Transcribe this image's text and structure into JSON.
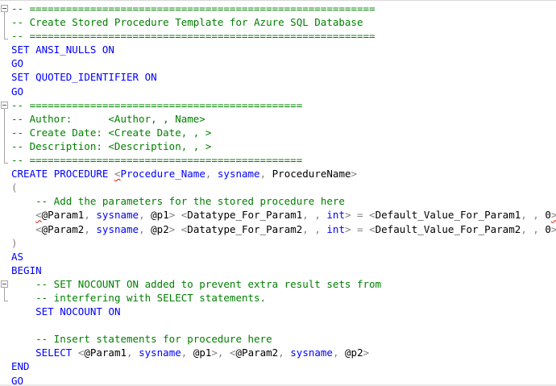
{
  "editor": {
    "lines": [
      [
        {
          "cls": "c",
          "text": "-- ========================================================="
        }
      ],
      [
        {
          "cls": "c",
          "text": "-- Create Stored Procedure Template for Azure SQL Database"
        }
      ],
      [
        {
          "cls": "c",
          "text": "-- ========================================================="
        }
      ],
      [
        {
          "cls": "k",
          "text": "SET"
        },
        {
          "cls": "p",
          "text": " "
        },
        {
          "cls": "k",
          "text": "ANSI_NULLS"
        },
        {
          "cls": "p",
          "text": " "
        },
        {
          "cls": "k",
          "text": "ON"
        }
      ],
      [
        {
          "cls": "k",
          "text": "GO"
        }
      ],
      [
        {
          "cls": "k",
          "text": "SET"
        },
        {
          "cls": "p",
          "text": " "
        },
        {
          "cls": "k",
          "text": "QUOTED_IDENTIFIER"
        },
        {
          "cls": "p",
          "text": " "
        },
        {
          "cls": "k",
          "text": "ON"
        }
      ],
      [
        {
          "cls": "k",
          "text": "GO"
        }
      ],
      [
        {
          "cls": "c",
          "text": "-- ============================================="
        }
      ],
      [
        {
          "cls": "c",
          "text": "-- Author:      <Author, , Name>"
        }
      ],
      [
        {
          "cls": "c",
          "text": "-- Create Date: <Create Date, , >"
        }
      ],
      [
        {
          "cls": "c",
          "text": "-- Description: <Description, , >"
        }
      ],
      [
        {
          "cls": "c",
          "text": "-- ============================================="
        }
      ],
      [
        {
          "cls": "k",
          "text": "CREATE"
        },
        {
          "cls": "p",
          "text": " "
        },
        {
          "cls": "k",
          "text": "PROCEDURE"
        },
        {
          "cls": "p",
          "text": " "
        },
        {
          "cls": "g squiggle",
          "text": "<"
        },
        {
          "cls": "t",
          "text": "Procedure_Name"
        },
        {
          "cls": "g",
          "text": ", "
        },
        {
          "cls": "t",
          "text": "sysname"
        },
        {
          "cls": "g",
          "text": ", "
        },
        {
          "cls": "p",
          "text": "ProcedureName"
        },
        {
          "cls": "g",
          "text": ">"
        }
      ],
      [
        {
          "cls": "g",
          "text": "("
        }
      ],
      [
        {
          "cls": "p",
          "text": "    "
        },
        {
          "cls": "c",
          "text": "-- Add the parameters for the stored procedure here"
        }
      ],
      [
        {
          "cls": "p",
          "text": "    "
        },
        {
          "cls": "g squiggle",
          "text": "<"
        },
        {
          "cls": "p",
          "text": "@Param1"
        },
        {
          "cls": "g",
          "text": ", "
        },
        {
          "cls": "t",
          "text": "sysname"
        },
        {
          "cls": "g",
          "text": ", "
        },
        {
          "cls": "p",
          "text": "@p1"
        },
        {
          "cls": "g",
          "text": "> <"
        },
        {
          "cls": "p",
          "text": "Datatype_For_Param1"
        },
        {
          "cls": "g",
          "text": ", , "
        },
        {
          "cls": "t",
          "text": "int"
        },
        {
          "cls": "g",
          "text": "> = <"
        },
        {
          "cls": "p",
          "text": "Default_Value_For_Param1"
        },
        {
          "cls": "g",
          "text": ", , "
        },
        {
          "cls": "p",
          "text": "0"
        },
        {
          "cls": "g squiggle",
          "text": ">"
        },
        {
          "cls": "g",
          "text": ","
        }
      ],
      [
        {
          "cls": "p",
          "text": "    "
        },
        {
          "cls": "g",
          "text": "<"
        },
        {
          "cls": "p",
          "text": "@Param2"
        },
        {
          "cls": "g",
          "text": ", "
        },
        {
          "cls": "t",
          "text": "sysname"
        },
        {
          "cls": "g",
          "text": ", "
        },
        {
          "cls": "p",
          "text": "@p2"
        },
        {
          "cls": "g",
          "text": "> <"
        },
        {
          "cls": "p",
          "text": "Datatype_For_Param2"
        },
        {
          "cls": "g",
          "text": ", , "
        },
        {
          "cls": "t",
          "text": "int"
        },
        {
          "cls": "g",
          "text": "> = <"
        },
        {
          "cls": "p",
          "text": "Default_Value_For_Param2"
        },
        {
          "cls": "g",
          "text": ", , "
        },
        {
          "cls": "p",
          "text": "0"
        },
        {
          "cls": "g",
          "text": ">"
        }
      ],
      [
        {
          "cls": "g",
          "text": ")"
        }
      ],
      [
        {
          "cls": "k",
          "text": "AS"
        }
      ],
      [
        {
          "cls": "k",
          "text": "BEGIN"
        }
      ],
      [
        {
          "cls": "p",
          "text": "    "
        },
        {
          "cls": "c",
          "text": "-- SET NOCOUNT ON added to prevent extra result sets from"
        }
      ],
      [
        {
          "cls": "p",
          "text": "    "
        },
        {
          "cls": "c",
          "text": "-- interfering with SELECT statements."
        }
      ],
      [
        {
          "cls": "p",
          "text": "    "
        },
        {
          "cls": "k",
          "text": "SET"
        },
        {
          "cls": "p",
          "text": " "
        },
        {
          "cls": "k",
          "text": "NOCOUNT"
        },
        {
          "cls": "p",
          "text": " "
        },
        {
          "cls": "k",
          "text": "ON"
        }
      ],
      [
        {
          "cls": "p",
          "text": ""
        }
      ],
      [
        {
          "cls": "p",
          "text": "    "
        },
        {
          "cls": "c",
          "text": "-- Insert statements for procedure here"
        }
      ],
      [
        {
          "cls": "p",
          "text": "    "
        },
        {
          "cls": "k",
          "text": "SELECT"
        },
        {
          "cls": "p",
          "text": " "
        },
        {
          "cls": "g",
          "text": "<"
        },
        {
          "cls": "p",
          "text": "@Param1"
        },
        {
          "cls": "g",
          "text": ", "
        },
        {
          "cls": "t",
          "text": "sysname"
        },
        {
          "cls": "g",
          "text": ", "
        },
        {
          "cls": "p",
          "text": "@p1"
        },
        {
          "cls": "g",
          "text": ">, <"
        },
        {
          "cls": "p",
          "text": "@Param2"
        },
        {
          "cls": "g",
          "text": ", "
        },
        {
          "cls": "t",
          "text": "sysname"
        },
        {
          "cls": "g",
          "text": ", "
        },
        {
          "cls": "p",
          "text": "@p2"
        },
        {
          "cls": "g",
          "text": ">"
        }
      ],
      [
        {
          "cls": "k",
          "text": "END"
        }
      ],
      [
        {
          "cls": "k",
          "text": "GO"
        }
      ]
    ],
    "folds": [
      {
        "start": 0,
        "end": 2
      },
      {
        "start": 7,
        "end": 11
      },
      {
        "start": 20,
        "end": 21
      }
    ]
  }
}
